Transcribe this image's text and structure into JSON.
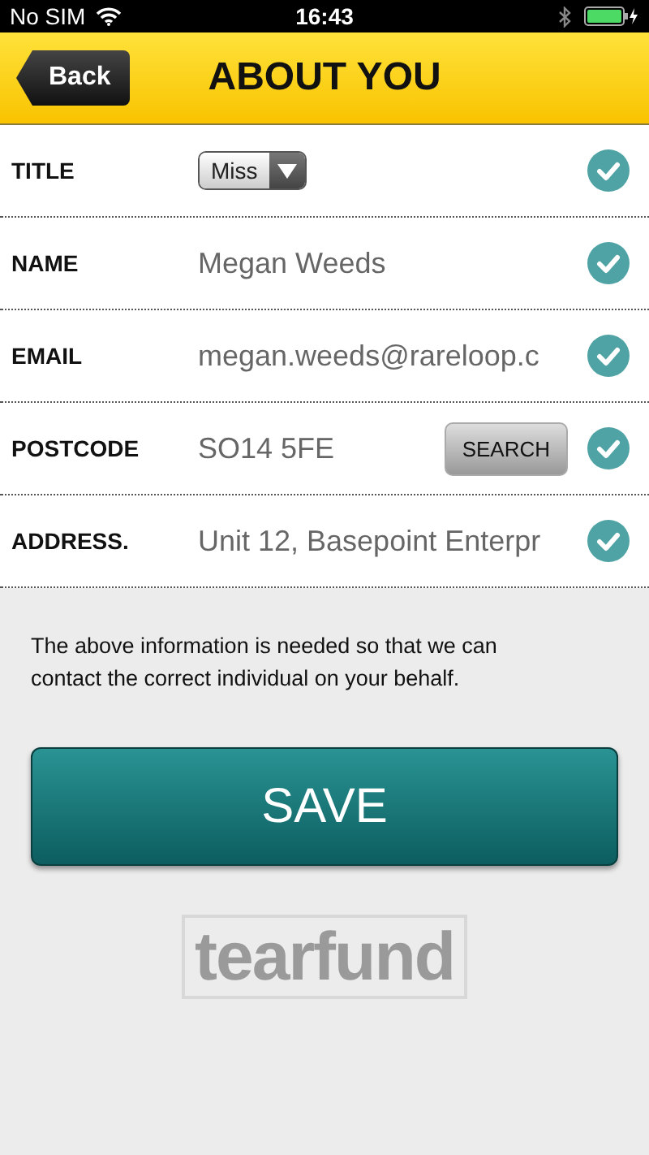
{
  "status_bar": {
    "carrier": "No SIM",
    "time": "16:43"
  },
  "header": {
    "back": "Back",
    "title": "ABOUT YOU"
  },
  "fields": [
    {
      "kind": "select",
      "label": "TITLE",
      "value": "Miss",
      "valid": true
    },
    {
      "kind": "text",
      "label": "NAME",
      "value": "Megan Weeds",
      "valid": true
    },
    {
      "kind": "text",
      "label": "EMAIL",
      "value": "megan.weeds@rareloop.c",
      "valid": true
    },
    {
      "kind": "search",
      "label": "POSTCODE",
      "value": "SO14 5FE",
      "button": "SEARCH",
      "valid": true
    },
    {
      "kind": "text",
      "label": "ADDRESS.",
      "value": "Unit 12, Basepoint Enterpr",
      "valid": true
    }
  ],
  "info": "The above information is needed so that we can contact the correct individual on your behalf.",
  "save": "SAVE",
  "logo": "tearfund"
}
